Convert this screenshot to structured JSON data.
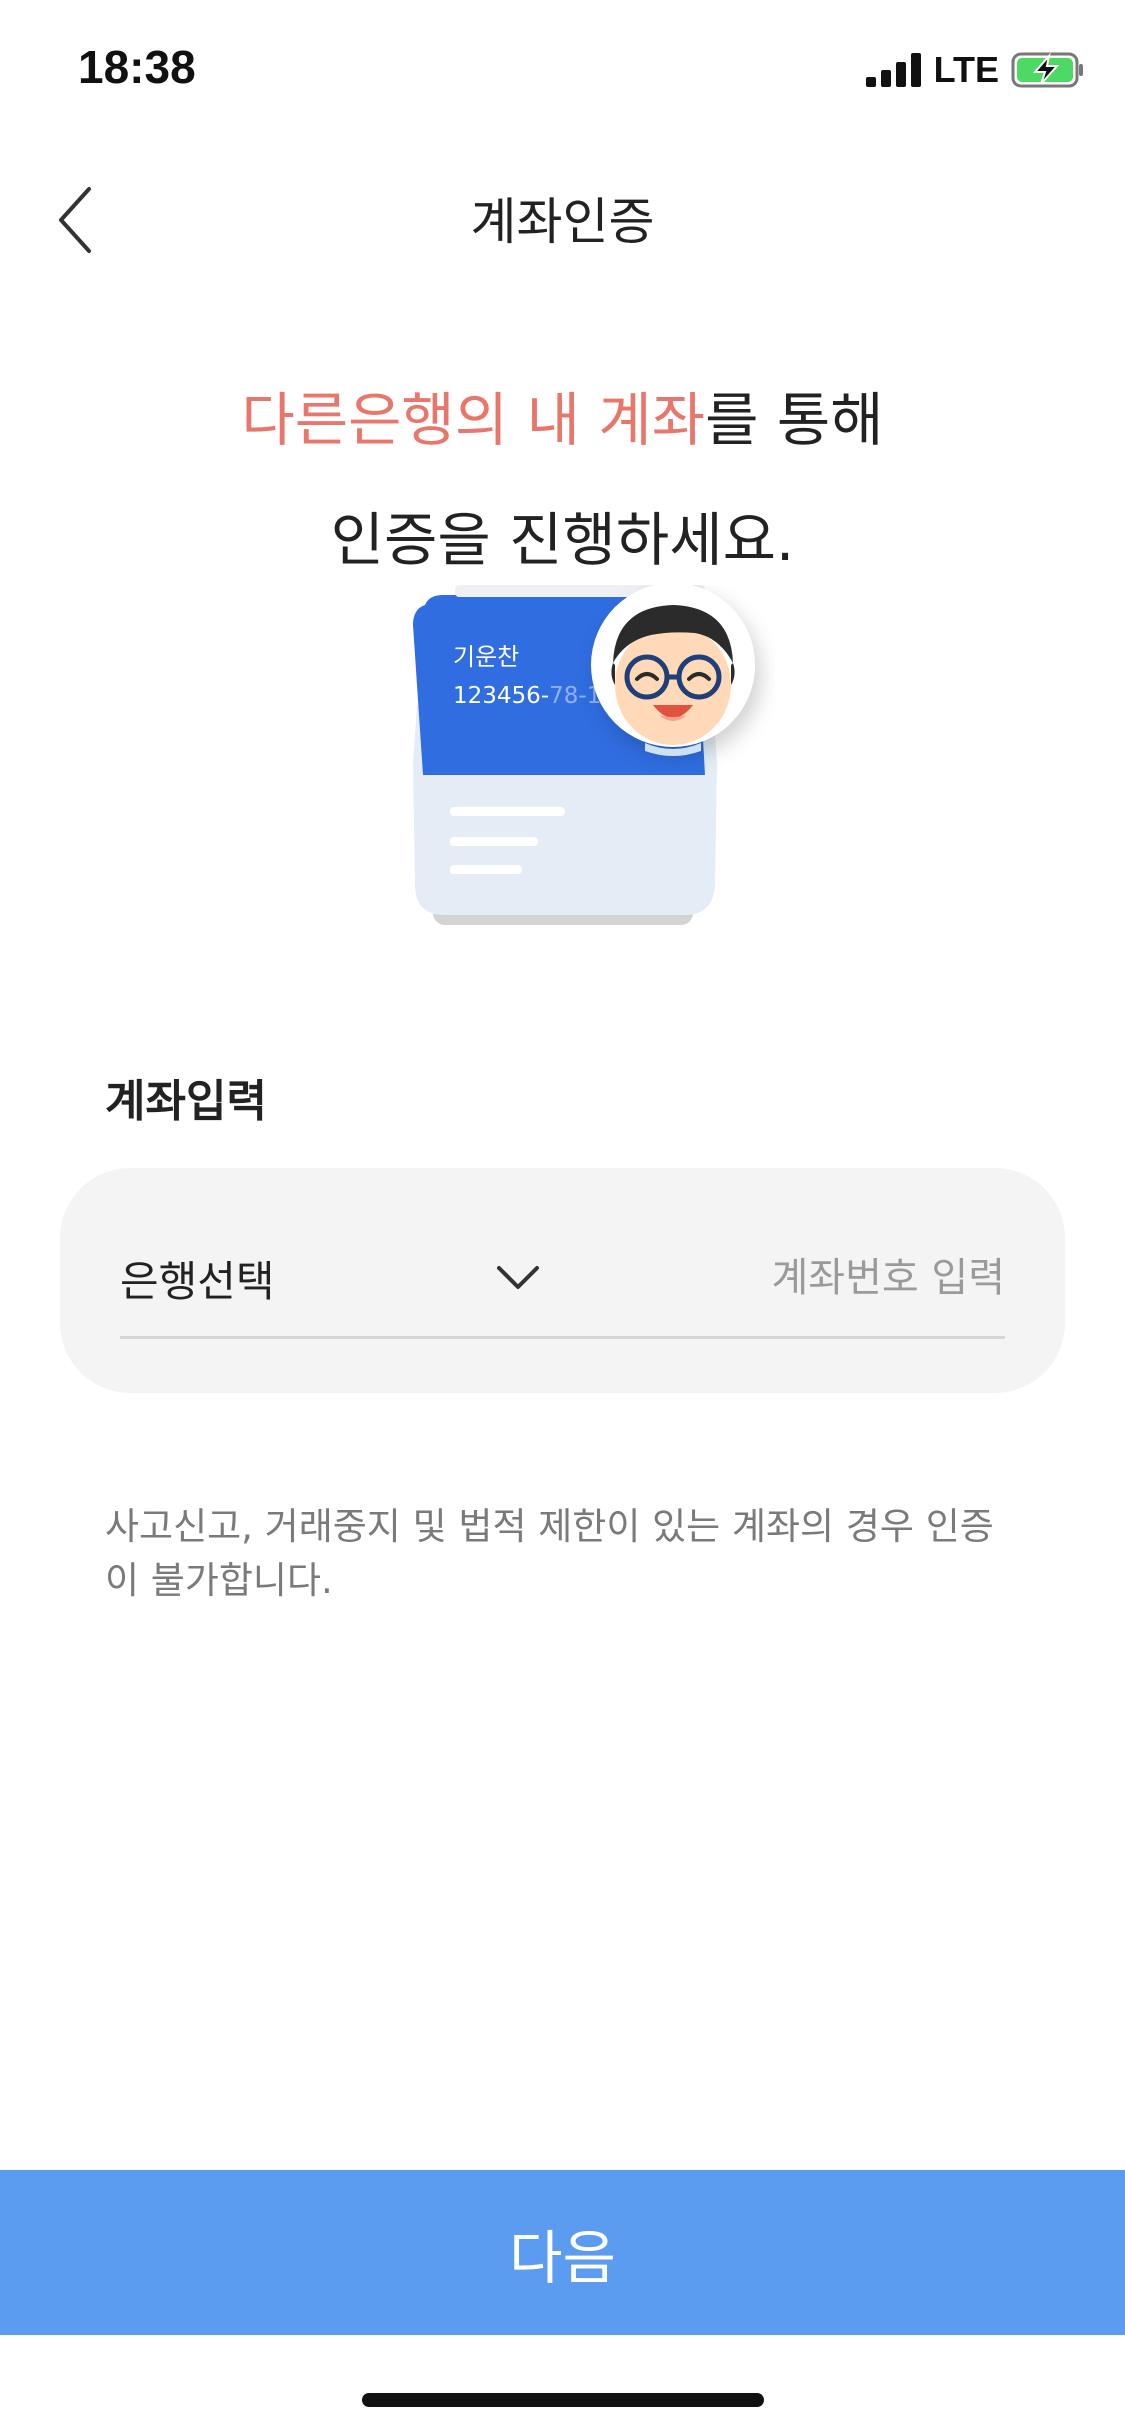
{
  "status_bar": {
    "time": "18:38",
    "network": "LTE",
    "icons": [
      "signal-bars-icon",
      "battery-charging-icon"
    ]
  },
  "nav": {
    "title": "계좌인증",
    "back_icon": "chevron-left-icon"
  },
  "headline": {
    "highlight": "다른은행의 내 계좌",
    "line1_rest": "를 통해",
    "line2": "인증을 진행하세요."
  },
  "illustration": {
    "card_name": "기운찬",
    "card_number_visible": "123456-",
    "card_number_faded": "78-1",
    "colors": {
      "card_blue": "#2f6de0",
      "card_light": "#e4edf6",
      "card_gray": "#d3d3d3"
    }
  },
  "form": {
    "section_label": "계좌입력",
    "bank_select_label": "은행선택",
    "account_placeholder": "계좌번호 입력"
  },
  "notice": "사고신고, 거래중지 및 법적 제한이 있는 계좌의 경우 인증이 불가합니다.",
  "next_button": "다음",
  "colors": {
    "accent": "#e8766a",
    "button": "#5b9bf0"
  }
}
